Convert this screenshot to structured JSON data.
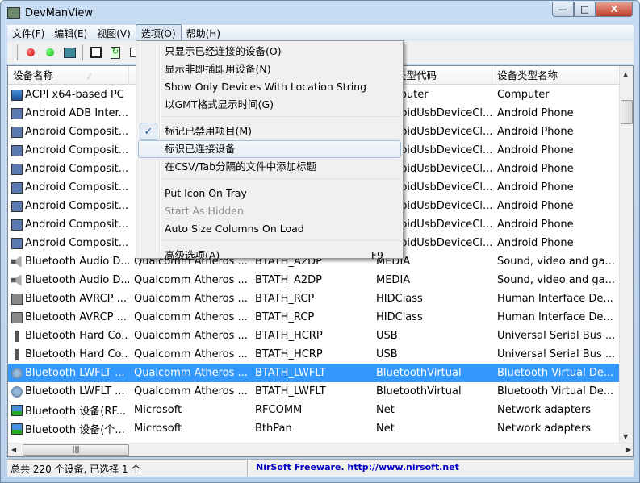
{
  "window": {
    "title": "DevManView",
    "min": "—",
    "max": "□",
    "close": "X"
  },
  "menubar": [
    "文件(F)",
    "编辑(E)",
    "视图(V)",
    "选项(O)",
    "帮助(H)"
  ],
  "toolbar": [
    "red-dot",
    "green-dot",
    "hardware",
    "save",
    "refresh",
    "copy"
  ],
  "columns": [
    "设备名称",
    "",
    "",
    "设备类型代码",
    "设备类型名称"
  ],
  "rows": [
    [
      "computer",
      "ACPI x64-based PC",
      "",
      "",
      "Computer",
      "Computer"
    ],
    [
      "android",
      "Android ADB Inter...",
      "",
      "",
      "AndroidUsbDeviceCl...",
      "Android Phone"
    ],
    [
      "android",
      "Android Composit...",
      "",
      "",
      "AndroidUsbDeviceCl...",
      "Android Phone"
    ],
    [
      "android",
      "Android Composit...",
      "",
      "",
      "AndroidUsbDeviceCl...",
      "Android Phone"
    ],
    [
      "android",
      "Android Composit...",
      "",
      "",
      "AndroidUsbDeviceCl...",
      "Android Phone"
    ],
    [
      "android",
      "Android Composit...",
      "",
      "",
      "AndroidUsbDeviceCl...",
      "Android Phone"
    ],
    [
      "android",
      "Android Composit...",
      "",
      "",
      "AndroidUsbDeviceCl...",
      "Android Phone"
    ],
    [
      "android",
      "Android Composit...",
      "",
      "",
      "AndroidUsbDeviceCl...",
      "Android Phone"
    ],
    [
      "android",
      "Android Composit...",
      "",
      "",
      "AndroidUsbDeviceCl...",
      "Android Phone"
    ],
    [
      "speaker",
      "Bluetooth Audio D...",
      "Qualcomm Atheros ...",
      "BTATH_A2DP",
      "MEDIA",
      "Sound, video and ga..."
    ],
    [
      "speaker",
      "Bluetooth Audio D...",
      "Qualcomm Atheros ...",
      "BTATH_A2DP",
      "MEDIA",
      "Sound, video and ga..."
    ],
    [
      "hid",
      "Bluetooth AVRCP ...",
      "Qualcomm Atheros ...",
      "BTATH_RCP",
      "HIDClass",
      "Human Interface De..."
    ],
    [
      "hid",
      "Bluetooth AVRCP ...",
      "Qualcomm Atheros ...",
      "BTATH_RCP",
      "HIDClass",
      "Human Interface De..."
    ],
    [
      "usb",
      "Bluetooth Hard Co...",
      "Qualcomm Atheros ...",
      "BTATH_HCRP",
      "USB",
      "Universal Serial Bus ..."
    ],
    [
      "usb",
      "Bluetooth Hard Co...",
      "Qualcomm Atheros ...",
      "BTATH_HCRP",
      "USB",
      "Universal Serial Bus ..."
    ],
    [
      "bt",
      "Bluetooth LWFLT ...",
      "Qualcomm Atheros ...",
      "BTATH_LWFLT",
      "BluetoothVirtual",
      "Bluetooth Virtual De..."
    ],
    [
      "bt",
      "Bluetooth LWFLT ...",
      "Qualcomm Atheros ...",
      "BTATH_LWFLT",
      "BluetoothVirtual",
      "Bluetooth Virtual De..."
    ],
    [
      "network",
      "Bluetooth 设备(RF...",
      "Microsoft",
      "RFCOMM",
      "Net",
      "Network adapters"
    ],
    [
      "network",
      "Bluetooth 设备(个...",
      "Microsoft",
      "BthPan",
      "Net",
      "Network adapters"
    ]
  ],
  "selected_row": 15,
  "options_menu": [
    {
      "label": "只显示已经连接的设备(O)"
    },
    {
      "label": "显示非即插即用设备(N)"
    },
    {
      "label": "Show Only Devices With Location String"
    },
    {
      "label": "以GMT格式显示时间(G)",
      "sep_after": true
    },
    {
      "label": "标记已禁用项目(M)",
      "checked": true
    },
    {
      "label": "标识已连接设备",
      "hover": true
    },
    {
      "label": "在CSV/Tab分隔的文件中添加标题",
      "sep_after": true
    },
    {
      "label": "Put Icon On Tray"
    },
    {
      "label": "Start As Hidden",
      "disabled": true
    },
    {
      "label": "Auto Size Columns On Load",
      "sep_after": true
    },
    {
      "label": "高级选项(A)",
      "shortcut": "F9"
    }
  ],
  "status": {
    "left": "总共 220 个设备, 已选择 1 个",
    "right": "NirSoft Freeware.  http://www.nirsoft.net"
  },
  "colors": {
    "selection": "#3399ff",
    "link": "#0000c0"
  }
}
